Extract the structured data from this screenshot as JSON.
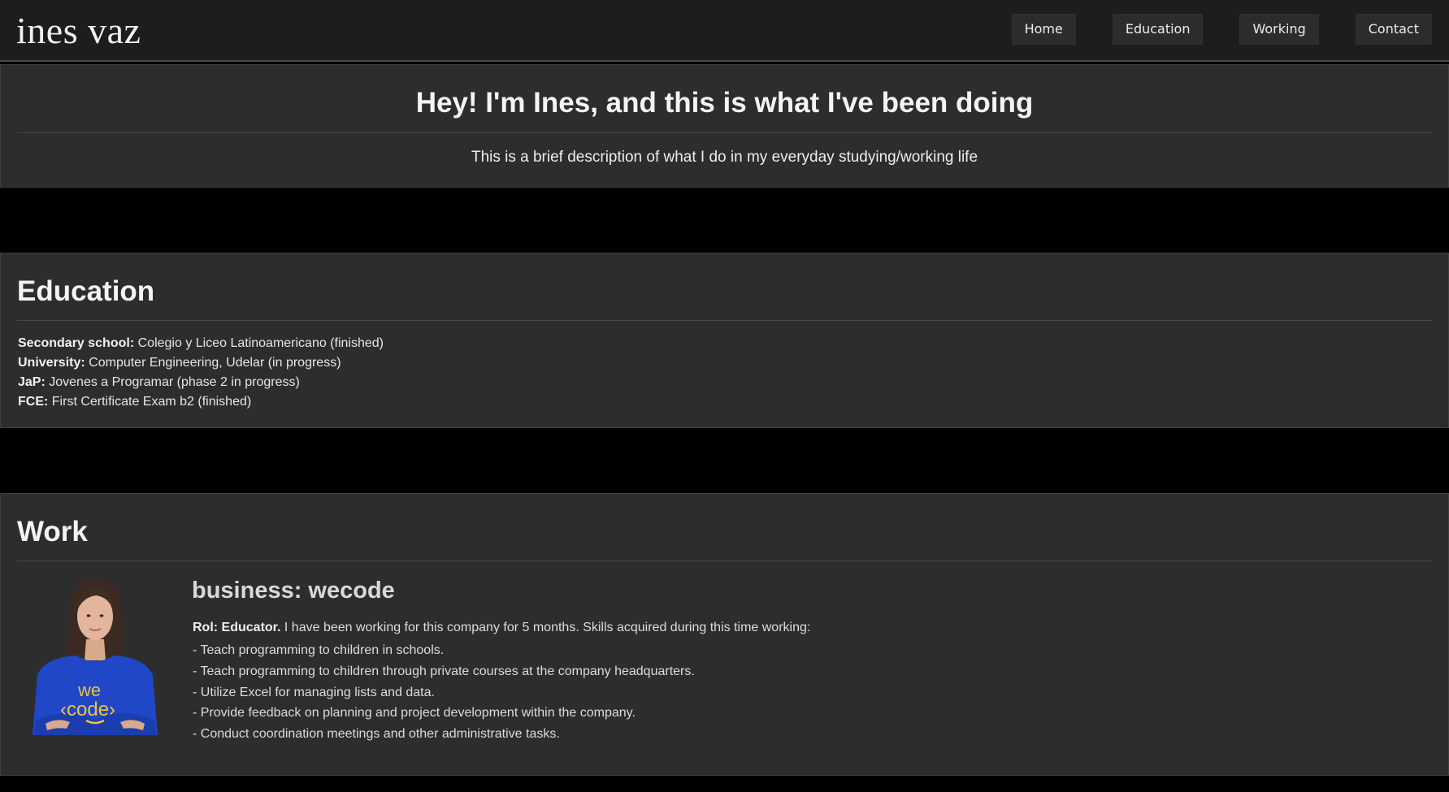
{
  "header": {
    "logo": "ines vaz",
    "nav": [
      "Home",
      "Education",
      "Working",
      "Contact"
    ]
  },
  "hero": {
    "title": "Hey! I'm Ines, and this is what I've been doing",
    "subtitle": "This is a brief description of what I do in my everyday studying/working life"
  },
  "education": {
    "heading": "Education",
    "items": [
      {
        "label": "Secondary school:",
        "value": "Colegio y Liceo Latinoamericano (finished)"
      },
      {
        "label": "University:",
        "value": "Computer Engineering, Udelar (in progress)"
      },
      {
        "label": "JaP:",
        "value": "Jovenes a Programar (phase 2 in progress)"
      },
      {
        "label": "FCE:",
        "value": "First Certificate Exam b2 (finished)"
      }
    ]
  },
  "work": {
    "heading": "Work",
    "business_title": "business: wecode",
    "role_label": "Rol: Educator.",
    "role_text": "I have been working for this company for 5 months. Skills acquired during this time working:",
    "skills": [
      "- Teach programming to children in schools.",
      "- Teach programming to children through private courses at the company headquarters.",
      "- Utilize Excel for managing lists and data.",
      "- Provide feedback on planning and project development within the company.",
      "- Conduct coordination meetings and other administrative tasks."
    ],
    "shirt_text_top": "we",
    "shirt_text_bottom": "‹code›"
  },
  "colors": {
    "page_bg": "#000000",
    "header_bg": "#1d1d1d",
    "panel_bg": "#2d2d2d",
    "nav_button_bg": "#2c2c2c",
    "shirt_blue": "#1f47c7",
    "shirt_text": "#f0c23a"
  }
}
